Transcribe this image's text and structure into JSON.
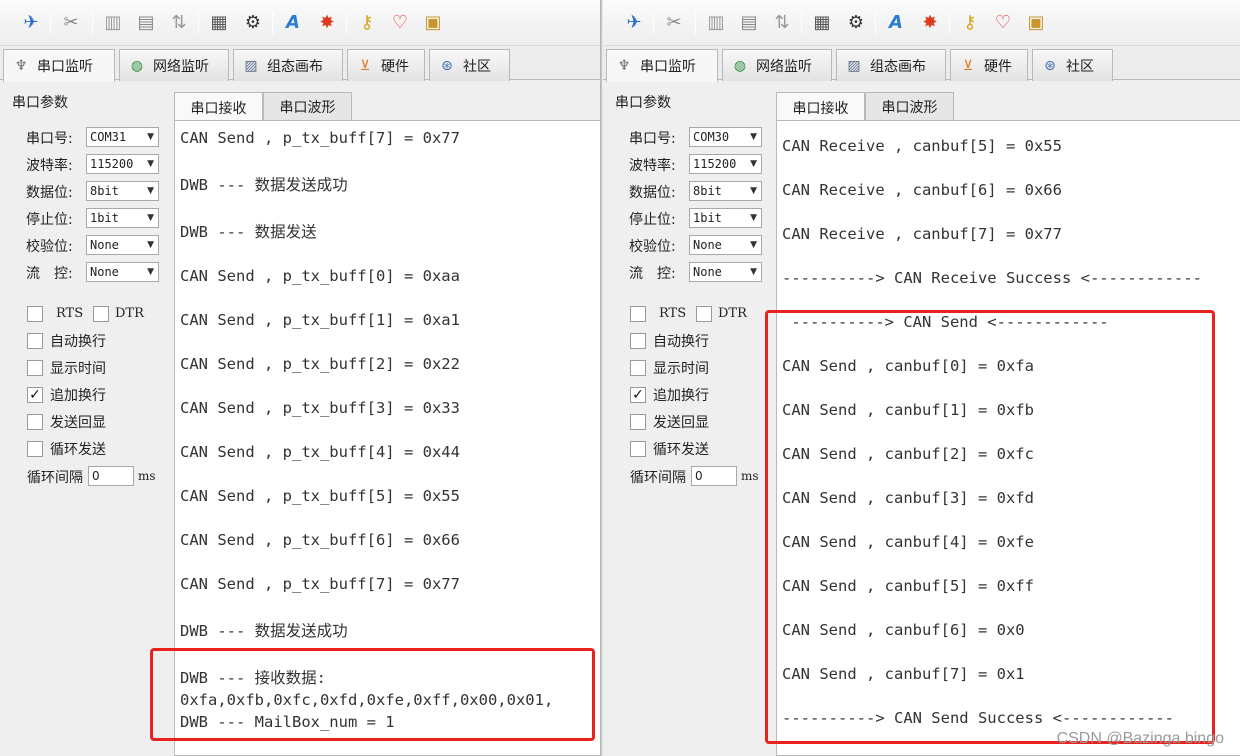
{
  "icons": {
    "toolbar": [
      "connect-icon",
      "settings-icon",
      "layout-icon",
      "window-icon",
      "sort-icon",
      "calculator-icon",
      "tools-icon",
      "font-icon",
      "fire-icon",
      "key-icon",
      "heart-icon",
      "book-icon"
    ]
  },
  "colors": {
    "highlight": "#e8231f"
  },
  "tabs": [
    "串口监听",
    "网络监听",
    "组态画布",
    "硬件",
    "社区"
  ],
  "params_title": "串口参数",
  "field_labels": {
    "port": "串口号:",
    "baud": "波特率:",
    "databits": "数据位:",
    "stopbits": "停止位:",
    "parity": "校验位:",
    "flow": "流　控:"
  },
  "options": {
    "rts": "RTS",
    "dtr": "DTR",
    "auto_wrap": "自动换行",
    "show_time": "显示时间",
    "append_newline": "追加换行",
    "echo": "发送回显",
    "loop_send": "循环发送",
    "loop_interval": "循环间隔",
    "ms": "ms"
  },
  "recv_tabs": {
    "receive": "串口接收",
    "wave": "串口波形"
  },
  "left": {
    "port": "COM31",
    "baud": "115200",
    "databits": "8bit",
    "stopbits": "1bit",
    "parity": "None",
    "flow": "None",
    "interval": "0",
    "append_checked": "✓",
    "lines": [
      "CAN Send , p_tx_buff[7] = 0x77",
      "DWB --- 数据发送成功",
      "DWB --- 数据发送",
      "CAN Send , p_tx_buff[0] = 0xaa",
      "CAN Send , p_tx_buff[1] = 0xa1",
      "CAN Send , p_tx_buff[2] = 0x22",
      "CAN Send , p_tx_buff[3] = 0x33",
      "CAN Send , p_tx_buff[4] = 0x44",
      "CAN Send , p_tx_buff[5] = 0x55",
      "CAN Send , p_tx_buff[6] = 0x66",
      "CAN Send , p_tx_buff[7] = 0x77",
      "DWB --- 数据发送成功",
      "DWB --- 接收数据:",
      "0xfa,0xfb,0xfc,0xfd,0xfe,0xff,0x00,0x01,",
      "DWB --- MailBox_num = 1"
    ]
  },
  "right": {
    "port": "COM30",
    "baud": "115200",
    "databits": "8bit",
    "stopbits": "1bit",
    "parity": "None",
    "flow": "None",
    "interval": "0",
    "append_checked": "✓",
    "lines": [
      "CAN Receive , canbuf[5] = 0x55",
      "CAN Receive , canbuf[6] = 0x66",
      "CAN Receive , canbuf[7] = 0x77",
      "----------> CAN Receive Success <------------",
      " ----------> CAN Send <------------",
      "CAN Send , canbuf[0] = 0xfa",
      "CAN Send , canbuf[1] = 0xfb",
      "CAN Send , canbuf[2] = 0xfc",
      "CAN Send , canbuf[3] = 0xfd",
      "CAN Send , canbuf[4] = 0xfe",
      "CAN Send , canbuf[5] = 0xff",
      "CAN Send , canbuf[6] = 0x0",
      "CAN Send , canbuf[7] = 0x1",
      "----------> CAN Send Success <------------"
    ]
  },
  "watermark": "CSDN @Bazinga bingo"
}
